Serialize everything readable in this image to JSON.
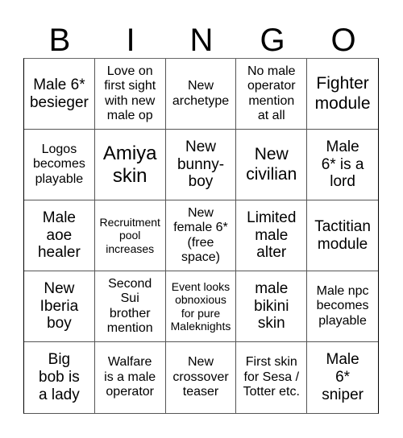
{
  "header": {
    "letters": [
      "B",
      "I",
      "N",
      "G",
      "O"
    ]
  },
  "grid": {
    "cells": [
      [
        "Male 6*",
        "besieger"
      ],
      [
        "Love on",
        "first sight",
        "with new",
        "male op"
      ],
      [
        "New",
        "archetype"
      ],
      [
        "No male",
        "operator",
        "mention",
        "at all"
      ],
      [
        "Fighter",
        "module"
      ],
      [
        "Logos",
        "becomes",
        "playable"
      ],
      [
        "Amiya",
        "skin"
      ],
      [
        "New",
        "bunny-",
        "boy"
      ],
      [
        "New",
        "civilian"
      ],
      [
        "Male",
        "6* is a",
        "lord"
      ],
      [
        "Male",
        "aoe",
        "healer"
      ],
      [
        "Recruitment",
        "pool",
        "increases"
      ],
      [
        "New",
        "female 6*",
        "(free",
        "space)"
      ],
      [
        "Limited",
        "male",
        "alter"
      ],
      [
        "Tactitian",
        "module"
      ],
      [
        "New",
        "Iberia",
        "boy"
      ],
      [
        "Second",
        "Sui",
        "brother",
        "mention"
      ],
      [
        "Event looks",
        "obnoxious",
        "for pure",
        "Maleknights"
      ],
      [
        "male",
        "bikini",
        "skin"
      ],
      [
        "Male npc",
        "becomes",
        "playable"
      ],
      [
        "Big",
        "bob is",
        "a lady"
      ],
      [
        "Walfare",
        "is a male",
        "operator"
      ],
      [
        "New",
        "crossover",
        "teaser"
      ],
      [
        "First skin",
        "for Sesa /",
        "Totter etc."
      ],
      [
        "Male",
        "6*",
        "sniper"
      ]
    ],
    "free_space_index": 12
  }
}
